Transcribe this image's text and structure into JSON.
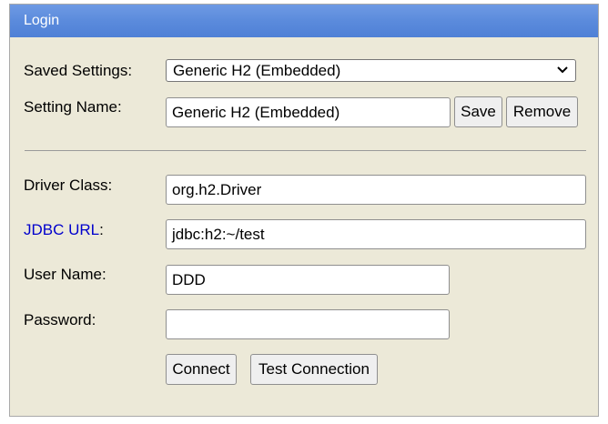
{
  "header": {
    "title": "Login"
  },
  "saved_settings": {
    "label": "Saved Settings:",
    "selected": "Generic H2 (Embedded)"
  },
  "setting_name": {
    "label": "Setting Name:",
    "value": "Generic H2 (Embedded)",
    "save_label": "Save",
    "remove_label": "Remove"
  },
  "driver_class": {
    "label": "Driver Class:",
    "value": "org.h2.Driver"
  },
  "jdbc_url": {
    "label_link": "JDBC URL",
    "label_suffix": ":",
    "value": "jdbc:h2:~/test"
  },
  "user_name": {
    "label": "User Name:",
    "value": "DDD"
  },
  "password": {
    "label": "Password:",
    "value": ""
  },
  "actions": {
    "connect_label": "Connect",
    "test_label": "Test Connection"
  }
}
